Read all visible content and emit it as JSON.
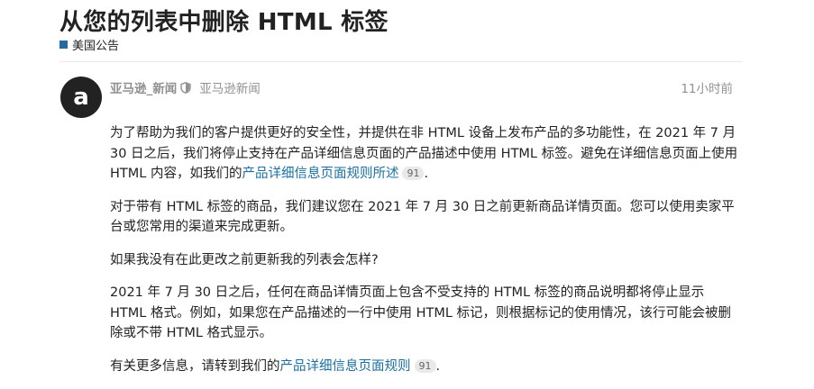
{
  "topic": {
    "title": "从您的列表中删除 HTML 标签",
    "category": "美国公告",
    "category_color": "#25699e"
  },
  "post": {
    "avatar_letter": "a",
    "username": "亚马逊_新闻",
    "full_name": "亚马逊新闻",
    "time": "11小时前",
    "p1_text": "为了帮助为我们的客户提供更好的安全性，并提供在非 HTML 设备上发布产品的多功能性，在 2021 年 7 月 30 日之后，我们将停止支持在产品详细信息页面的产品描述中使用 HTML 标签。避免在详细信息页面上使用 HTML 内容，如我们的",
    "p1_link": "产品详细信息页面规则所述",
    "p1_link_count": "91",
    "p1_end": ".",
    "p2": "对于带有 HTML 标签的商品，我们建议您在 2021 年 7 月 30 日之前更新商品详情页面。您可以使用卖家平台或您常用的渠道来完成更新。",
    "p3": "如果我没有在此更改之前更新我的列表会怎样?",
    "p4": "2021 年 7 月 30 日之后，任何在商品详情页面上包含不受支持的 HTML 标签的商品说明都将停止显示 HTML 格式。例如，如果您在产品描述的一行中使用 HTML 标记，则根据标记的使用情况，该行可能会被删除或不带 HTML 格式显示。",
    "p5_text": "有关更多信息，请转到我们的",
    "p5_link": "产品详细信息页面规则",
    "p5_link_count": "91",
    "p5_end": "."
  },
  "colors": {
    "link": "#1a6fa0",
    "muted": "#919191",
    "avatar_bg": "#222222"
  },
  "icons": {
    "moderator": "shield-icon"
  }
}
